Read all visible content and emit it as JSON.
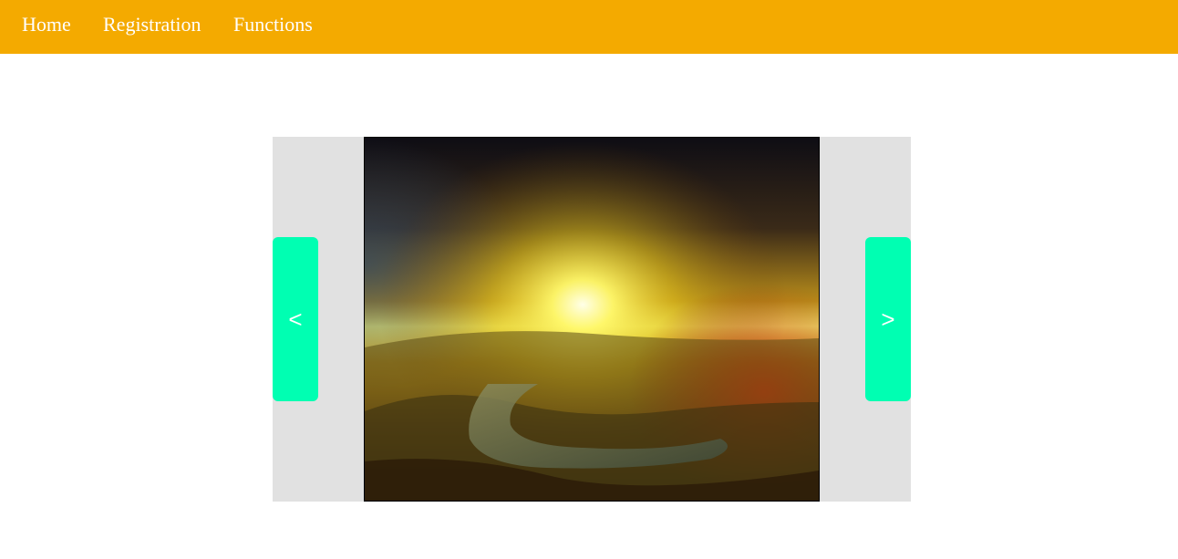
{
  "nav": {
    "items": [
      {
        "label": "Home"
      },
      {
        "label": "Registration"
      },
      {
        "label": "Functions"
      }
    ],
    "background": "#f4aa00",
    "text_color": "#ffffff"
  },
  "slider": {
    "prev_label": "<",
    "next_label": ">",
    "arrow_color": "#00ffb2",
    "background": "#e1e1e1"
  }
}
